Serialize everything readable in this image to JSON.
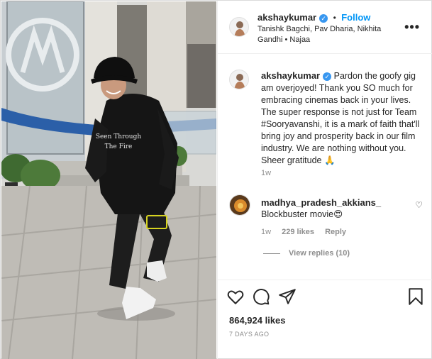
{
  "post": {
    "author": "akshaykumar",
    "follow_label": "Follow",
    "separator": "•",
    "tagged_people": "Tanishk Bagchi, Pav Dharia, Nikhita Gandhi • Najaa",
    "more_icon": "more-options-icon",
    "hoodie_text_line1": "Seen Through",
    "hoodie_text_line2": "The Fire"
  },
  "caption": {
    "author": "akshaykumar",
    "text": "Pardon the goofy gig am overjoyed! Thank you SO much for embracing cinemas back in your lives. The super response is not just for Team #Sooryavanshi, it is a mark of faith that'll bring joy and prosperity back in our film industry. We are nothing without you. Sheer gratitude 🙏",
    "age": "1w"
  },
  "comments": [
    {
      "author": "madhya_pradesh_akkians_",
      "text": "Blockbuster movie😍",
      "age": "1w",
      "likes": "229 likes",
      "reply_label": "Reply",
      "view_replies": "View replies (10)"
    }
  ],
  "footer": {
    "likes": "864,924 likes",
    "date": "7 DAYS AGO"
  },
  "colors": {
    "accent": "#0095f6",
    "verified": "#3897f0",
    "muted": "#8e8e8e",
    "heart_emoji": "#ed4956"
  }
}
